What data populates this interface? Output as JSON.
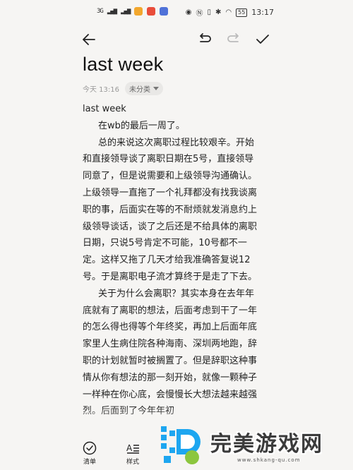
{
  "status_bar": {
    "left_text": "3G",
    "battery": "55",
    "time": "13:17"
  },
  "note": {
    "title": "last week",
    "date": "今天 13:16",
    "category": "未分类"
  },
  "content": {
    "lines": [
      "last week",
      "在wb的最后一周了。",
      "总的来说这次离职过程比较艰辛。开始",
      "和直接领导谈了离职日期在5号，直接领导",
      "同意了，但是说需要和上级领导沟通确认。",
      "上级领导一直拖了一个礼拜都没有找我谈离",
      "职的事，后面实在等的不耐烦就发消息约上",
      "级领导谈话，谈了之后还是不给具体的离职",
      "日期，只说5号肯定不可能，10号都不一",
      "定。这样又拖了几天才给我准确答复说12",
      "号。于是离职电子流才算终于是走了下去。",
      "关于为什么会离职？其实本身在去年年",
      "底就有了离职的想法，后面考虑到干了一年",
      "的怎么得也得等个年终奖，再加上后面年底",
      "家里人生病住院各种海南、深圳两地跑，辞",
      "职的计划就暂时被搁置了。但是辞职这种事",
      "情从你有想法的那一刻开始，就像一颗种子",
      "一样种在你心底，会慢慢长大想法越来越强",
      "烈。后面到了今年年初"
    ]
  },
  "bottom_bar": {
    "checklist_label": "清单",
    "style_label": "样式"
  },
  "watermark": {
    "text": "完美游戏网",
    "url": "www.shkang-qu.com"
  },
  "colors": {
    "background": "#f6f5f3",
    "text": "#222222",
    "meta": "#999999"
  }
}
